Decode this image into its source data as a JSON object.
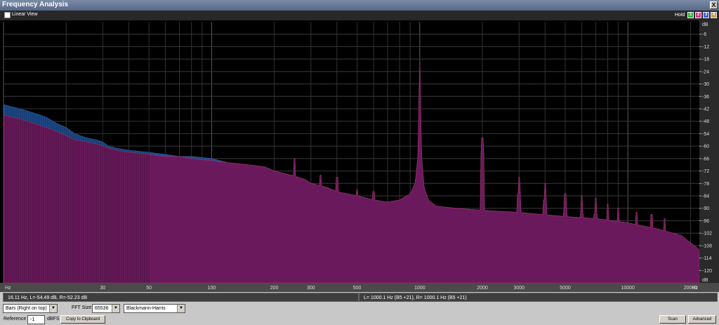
{
  "window": {
    "title": "Frequency Analysis",
    "close_label": "X"
  },
  "toolbar": {
    "linear_view_label": "Linear View",
    "hold_label": "Hold",
    "hold_buttons": [
      {
        "label": "1",
        "color": "#3ab03a"
      },
      {
        "label": "2",
        "color": "#d03090"
      },
      {
        "label": "3",
        "color": "#3a60d0"
      },
      {
        "label": "4",
        "color": "#c0a040"
      }
    ]
  },
  "status": {
    "left": "16.11 Hz, L=-54.49 dB, R=-52.23 dB",
    "right": "L= 1000.1 Hz (B5 +21), R= 1000.1 Hz (B5 +21)"
  },
  "controls": {
    "mode_value": "Bars (Right on top)",
    "fft_label": "FFT Size",
    "fft_value": "65536",
    "window_value": "Blackmann-Harris",
    "reference_label": "Reference",
    "reference_value": "-1",
    "dbfs_label": "dBFS",
    "copy_label": "Copy to Clipboard",
    "scan_label": "Scan",
    "advanced_label": "Advanced"
  },
  "chart_data": {
    "type": "area",
    "xscale": "log",
    "xlim": [
      10,
      22050
    ],
    "ylim": [
      -126,
      0
    ],
    "grid": true,
    "x_tick_labels": [
      "Hz",
      "30",
      "50",
      "100",
      "200",
      "300",
      "500",
      "1000",
      "2000",
      "3000",
      "5000",
      "10000",
      "20000"
    ],
    "x_ticks": [
      10,
      30,
      50,
      100,
      200,
      300,
      500,
      1000,
      2000,
      3000,
      5000,
      10000,
      20000
    ],
    "x_tick_suffix": "Hz",
    "y_ticks": [
      -6,
      -12,
      -18,
      -24,
      -30,
      -36,
      -42,
      -48,
      -54,
      -60,
      -66,
      -72,
      -78,
      -84,
      -90,
      -96,
      -102,
      -108,
      -114,
      -120
    ],
    "y_top_label": "dB",
    "y_bottom_label": "dB",
    "series": [
      {
        "channel": "Left",
        "color": "#1c4a8a",
        "x": [
          10,
          12,
          14,
          16,
          18,
          20,
          22,
          25,
          28,
          30,
          32,
          35,
          40,
          50,
          60,
          70,
          80,
          100,
          120,
          150,
          180,
          200,
          240,
          280,
          300,
          360,
          400,
          500,
          600,
          700,
          800,
          900,
          950,
          980,
          1000,
          1020,
          1050,
          1100,
          1200,
          1500,
          2000,
          3000,
          5000,
          7000,
          10000,
          14000,
          18000,
          22050
        ],
        "y": [
          -40,
          -42,
          -44,
          -46,
          -49,
          -51,
          -54,
          -56,
          -57,
          -58,
          -60,
          -61,
          -62,
          -63,
          -64,
          -65,
          -65,
          -66,
          -68,
          -69,
          -70,
          -72,
          -74,
          -76,
          -78,
          -80,
          -82,
          -84,
          -86,
          -87,
          -86,
          -83,
          -78,
          -65,
          -16,
          -65,
          -80,
          -86,
          -89,
          -90,
          -91,
          -92,
          -94,
          -95,
          -97,
          -101,
          -106,
          -114
        ]
      },
      {
        "channel": "Right",
        "color": "#6a1a5c",
        "x": [
          10,
          12,
          14,
          16,
          18,
          20,
          22,
          25,
          28,
          30,
          32,
          35,
          40,
          50,
          60,
          70,
          80,
          100,
          120,
          150,
          180,
          200,
          240,
          280,
          300,
          360,
          400,
          500,
          600,
          700,
          800,
          900,
          950,
          980,
          1000,
          1020,
          1050,
          1100,
          1200,
          1500,
          2000,
          3000,
          5000,
          7000,
          10000,
          14000,
          18000,
          22050
        ],
        "y": [
          -45,
          -47,
          -49,
          -51,
          -53,
          -55,
          -57,
          -58,
          -59,
          -60,
          -61,
          -62,
          -63,
          -64,
          -65,
          -65,
          -66,
          -67,
          -68,
          -69,
          -70,
          -72,
          -74,
          -76,
          -78,
          -80,
          -82,
          -84,
          -86,
          -87,
          -86,
          -83,
          -78,
          -65,
          -16,
          -65,
          -80,
          -86,
          -89,
          -90,
          -91,
          -92,
          -94,
          -95,
          -97,
          -100,
          -103,
          -110
        ]
      }
    ],
    "harmonic_peaks": [
      {
        "x": 250,
        "y": -66
      },
      {
        "x": 333,
        "y": -74
      },
      {
        "x": 400,
        "y": -75
      },
      {
        "x": 500,
        "y": -81
      },
      {
        "x": 600,
        "y": -82
      },
      {
        "x": 2000,
        "y": -56
      },
      {
        "x": 3000,
        "y": -75
      },
      {
        "x": 4000,
        "y": -78
      },
      {
        "x": 5000,
        "y": -83
      },
      {
        "x": 6000,
        "y": -84
      },
      {
        "x": 7000,
        "y": -85
      },
      {
        "x": 8000,
        "y": -88
      },
      {
        "x": 9000,
        "y": -90
      },
      {
        "x": 11000,
        "y": -92
      },
      {
        "x": 13000,
        "y": -93
      },
      {
        "x": 15000,
        "y": -95
      }
    ]
  }
}
